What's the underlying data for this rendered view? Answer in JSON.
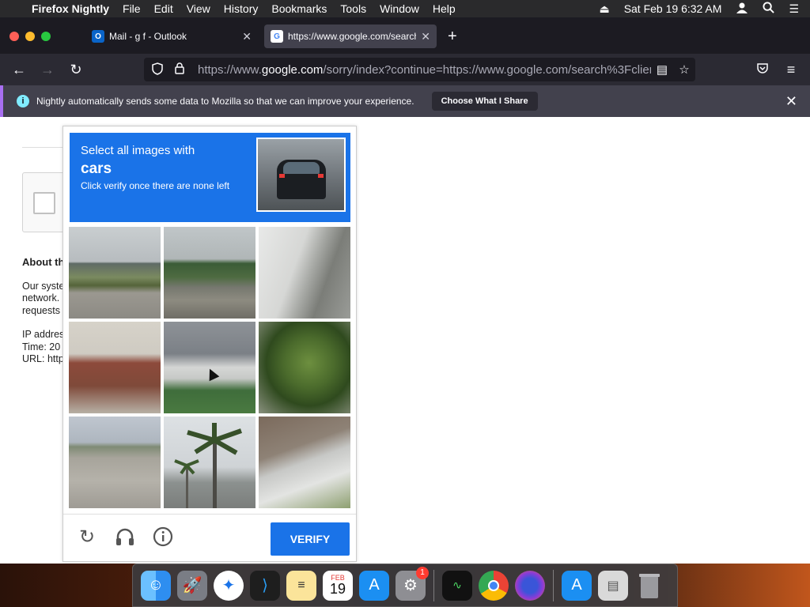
{
  "menubar": {
    "app": "Firefox Nightly",
    "items": [
      "File",
      "Edit",
      "View",
      "History",
      "Bookmarks",
      "Tools",
      "Window",
      "Help"
    ],
    "datetime": "Sat Feb 19  6:32 AM"
  },
  "tabs": [
    {
      "label": "Mail - g f - Outlook",
      "favicon": "O"
    },
    {
      "label": "https://www.google.com/search",
      "favicon": "G"
    }
  ],
  "urlbar": {
    "url_prefix": "https://www.",
    "url_domain": "google.com",
    "url_rest": "/sorry/index?continue=https://www.google.com/search%3Fclient%"
  },
  "notification": {
    "message": "Nightly automatically sends some data to Mozilla so that we can improve your experience.",
    "button": "Choose What I Share"
  },
  "page": {
    "about_heading": "About th",
    "lines": [
      "Our syste",
      "network.",
      "requests"
    ],
    "ip_line": "IP addres",
    "time_line": "Time: 20",
    "url_line": "URL: http"
  },
  "captcha": {
    "prompt": "Select all images with",
    "target": "cars",
    "instruction": "Click verify once there are none left",
    "tiles": [
      "railway-field",
      "railway-train",
      "outdoor-stairs",
      "front-porch-steps",
      "house-porch",
      "palm-tree",
      "empty-road",
      "palm-trees-street",
      "building-stairs"
    ],
    "verify_label": "VERIFY"
  },
  "dock": {
    "calendar_month": "FEB",
    "calendar_day": "19",
    "settings_badge": "1"
  }
}
